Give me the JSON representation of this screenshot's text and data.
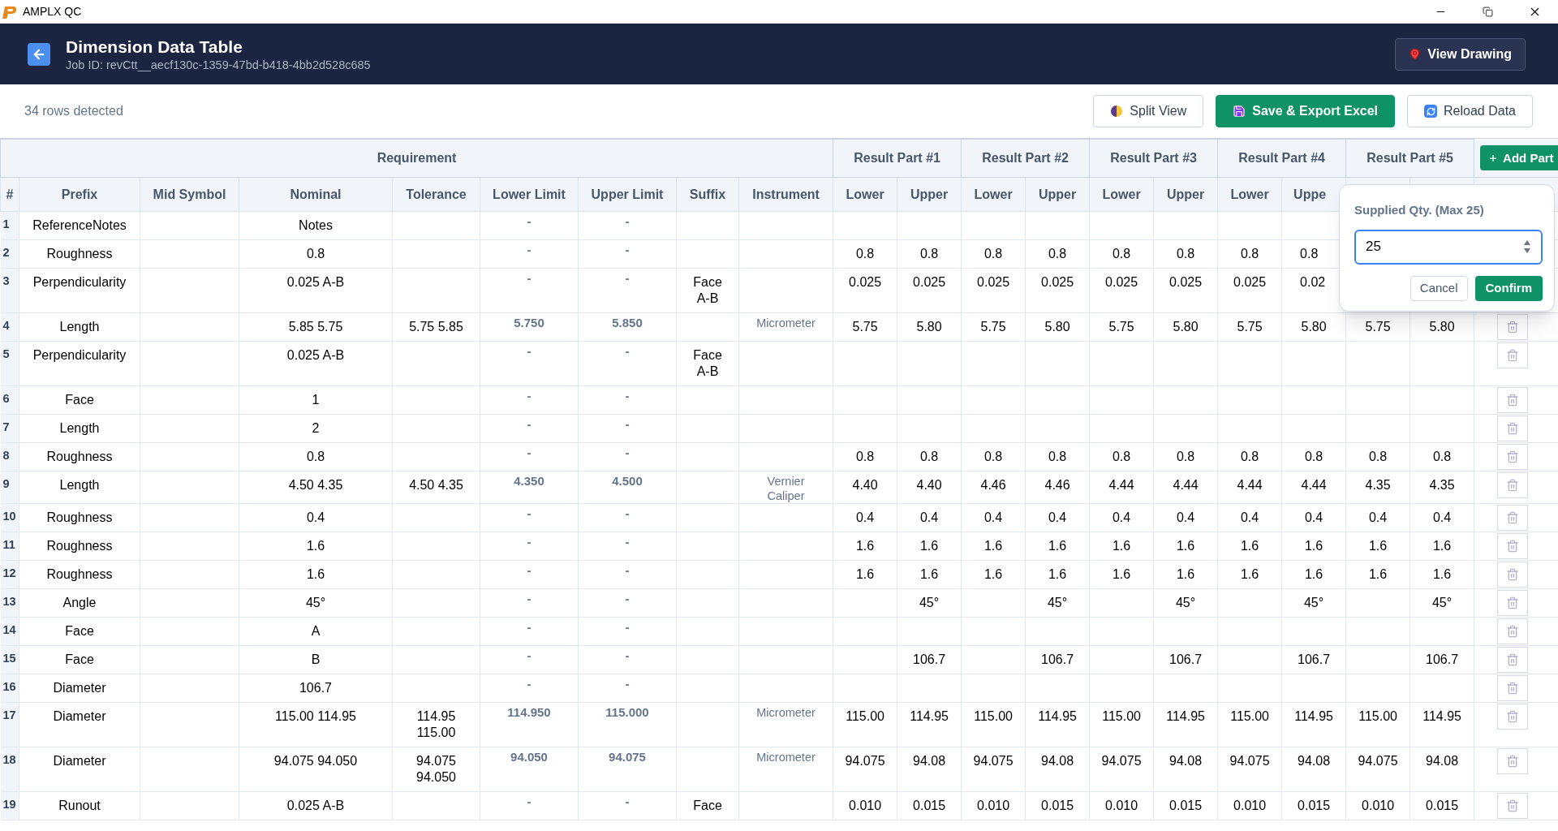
{
  "window": {
    "title": "AMPLX QC"
  },
  "header": {
    "title": "Dimension Data Table",
    "subtitle": "Job ID: revCtt__aecf130c-1359-47bd-b418-4bb2d528c685",
    "view_button": "View Drawing"
  },
  "toolbar": {
    "row_count": "34 rows detected",
    "buttons": [
      {
        "kind": "split",
        "label": "Split View"
      },
      {
        "kind": "save",
        "label": "Save & Export Excel"
      },
      {
        "kind": "reload",
        "label": "Reload Data"
      }
    ]
  },
  "table": {
    "requirement_header": "Requirement",
    "result_headers": [
      "Result Part #1",
      "Result Part #2",
      "Result Part #3",
      "Result Part #4",
      "Result Part #5"
    ],
    "add_part": "Add Part",
    "columns": [
      "#",
      "Prefix",
      "Mid Symbol",
      "Nominal",
      "Tolerance",
      "Lower Limit",
      "Upper Limit",
      "Suffix",
      "Instrument"
    ],
    "result_columns": [
      "Lower",
      "Upper",
      "Lower",
      "Upper",
      "Lower",
      "Upper",
      "Lower",
      "Uppe",
      {
        "kind": "empty"
      },
      {
        "kind": "empty"
      }
    ],
    "rows": [
      {
        "num": "1",
        "prefix": "ReferenceNotes",
        "nominal": "Notes",
        "lower": "-",
        "upper": "-",
        "results": [
          {
            "kind": "empty"
          },
          {
            "kind": "empty"
          },
          {
            "kind": "empty"
          },
          {
            "kind": "empty"
          },
          {
            "kind": "empty"
          },
          {
            "kind": "empty"
          },
          {
            "kind": "empty"
          },
          {
            "kind": "empty"
          },
          {
            "kind": "empty"
          },
          {
            "kind": "empty"
          }
        ]
      },
      {
        "num": "2",
        "prefix": "Roughness",
        "nominal": "0.8",
        "lower": "-",
        "upper": "-",
        "results": [
          "0.8",
          "0.8",
          "0.8",
          "0.8",
          "0.8",
          "0.8",
          "0.8",
          "0.8",
          {
            "kind": "empty"
          },
          {
            "kind": "empty"
          }
        ]
      },
      {
        "num": "3",
        "prefix": "Perpendicularity",
        "nominal": "0.025 A-B",
        "lower": "-",
        "upper": "-",
        "suffix": "Face A-B",
        "results": [
          "0.025",
          "0.025",
          "0.025",
          "0.025",
          "0.025",
          "0.025",
          "0.025",
          "0.02",
          {
            "kind": "empty"
          },
          {
            "kind": "empty"
          }
        ]
      },
      {
        "num": "4",
        "prefix": "Length",
        "nominal": "5.85 5.75",
        "tolerance": "5.75 5.85",
        "lower": "5.750",
        "upper": "5.850",
        "instrument": "Micrometer",
        "results": [
          "5.75",
          "5.80",
          "5.75",
          "5.80",
          "5.75",
          "5.80",
          "5.75",
          "5.80",
          "5.75",
          "5.80"
        ],
        "trash": true
      },
      {
        "num": "5",
        "prefix": "Perpendicularity",
        "nominal": "0.025 A-B",
        "lower": "-",
        "upper": "-",
        "suffix": "Face A-B",
        "results": [
          {
            "kind": "empty"
          },
          {
            "kind": "empty"
          },
          {
            "kind": "empty"
          },
          {
            "kind": "empty"
          },
          {
            "kind": "empty"
          },
          {
            "kind": "empty"
          },
          {
            "kind": "empty"
          },
          {
            "kind": "empty"
          },
          {
            "kind": "empty"
          },
          {
            "kind": "empty"
          }
        ],
        "trash": true
      },
      {
        "num": "6",
        "prefix": "Face",
        "nominal": "1",
        "lower": "-",
        "upper": "-",
        "results": [
          {
            "kind": "empty"
          },
          {
            "kind": "empty"
          },
          {
            "kind": "empty"
          },
          {
            "kind": "empty"
          },
          {
            "kind": "empty"
          },
          {
            "kind": "empty"
          },
          {
            "kind": "empty"
          },
          {
            "kind": "empty"
          },
          {
            "kind": "empty"
          },
          {
            "kind": "empty"
          }
        ],
        "trash": true
      },
      {
        "num": "7",
        "prefix": "Length",
        "nominal": "2",
        "lower": "-",
        "upper": "-",
        "results": [
          {
            "kind": "empty"
          },
          {
            "kind": "empty"
          },
          {
            "kind": "empty"
          },
          {
            "kind": "empty"
          },
          {
            "kind": "empty"
          },
          {
            "kind": "empty"
          },
          {
            "kind": "empty"
          },
          {
            "kind": "empty"
          },
          {
            "kind": "empty"
          },
          {
            "kind": "empty"
          }
        ],
        "trash": true
      },
      {
        "num": "8",
        "prefix": "Roughness",
        "nominal": "0.8",
        "lower": "-",
        "upper": "-",
        "results": [
          "0.8",
          "0.8",
          "0.8",
          "0.8",
          "0.8",
          "0.8",
          "0.8",
          "0.8",
          "0.8",
          "0.8"
        ],
        "trash": true
      },
      {
        "num": "9",
        "prefix": "Length",
        "nominal": "4.50 4.35",
        "tolerance": "4.50 4.35",
        "lower": "4.350",
        "upper": "4.500",
        "instrument": "Vernier Caliper",
        "results": [
          "4.40",
          "4.40",
          "4.46",
          "4.46",
          "4.44",
          "4.44",
          "4.44",
          "4.44",
          "4.35",
          "4.35"
        ],
        "trash": true
      },
      {
        "num": "10",
        "prefix": "Roughness",
        "nominal": "0.4",
        "lower": "-",
        "upper": "-",
        "results": [
          "0.4",
          "0.4",
          "0.4",
          "0.4",
          "0.4",
          "0.4",
          "0.4",
          "0.4",
          "0.4",
          "0.4"
        ],
        "trash": true
      },
      {
        "num": "11",
        "prefix": "Roughness",
        "nominal": "1.6",
        "lower": "-",
        "upper": "-",
        "results": [
          "1.6",
          "1.6",
          "1.6",
          "1.6",
          "1.6",
          "1.6",
          "1.6",
          "1.6",
          "1.6",
          "1.6"
        ],
        "trash": true
      },
      {
        "num": "12",
        "prefix": "Roughness",
        "nominal": "1.6",
        "lower": "-",
        "upper": "-",
        "results": [
          "1.6",
          "1.6",
          "1.6",
          "1.6",
          "1.6",
          "1.6",
          "1.6",
          "1.6",
          "1.6",
          "1.6"
        ],
        "trash": true
      },
      {
        "num": "13",
        "prefix": "Angle",
        "nominal": "45°",
        "lower": "-",
        "upper": "-",
        "results": [
          {
            "kind": "empty"
          },
          "45°",
          {
            "kind": "empty"
          },
          "45°",
          {
            "kind": "empty"
          },
          "45°",
          {
            "kind": "empty"
          },
          "45°",
          {
            "kind": "empty"
          },
          "45°"
        ],
        "trash": true
      },
      {
        "num": "14",
        "prefix": "Face",
        "nominal": "A",
        "lower": "-",
        "upper": "-",
        "results": [
          {
            "kind": "empty"
          },
          {
            "kind": "empty"
          },
          {
            "kind": "empty"
          },
          {
            "kind": "empty"
          },
          {
            "kind": "empty"
          },
          {
            "kind": "empty"
          },
          {
            "kind": "empty"
          },
          {
            "kind": "empty"
          },
          {
            "kind": "empty"
          },
          {
            "kind": "empty"
          }
        ],
        "trash": true
      },
      {
        "num": "15",
        "prefix": "Face",
        "nominal": "B",
        "lower": "-",
        "upper": "-",
        "results": [
          {
            "kind": "empty"
          },
          "106.7",
          {
            "kind": "empty"
          },
          "106.7",
          {
            "kind": "empty"
          },
          "106.7",
          {
            "kind": "empty"
          },
          "106.7",
          {
            "kind": "empty"
          },
          "106.7"
        ],
        "trash": true
      },
      {
        "num": "16",
        "prefix": "Diameter",
        "nominal": "106.7",
        "lower": "-",
        "upper": "-",
        "results": [
          {
            "kind": "empty"
          },
          {
            "kind": "empty"
          },
          {
            "kind": "empty"
          },
          {
            "kind": "empty"
          },
          {
            "kind": "empty"
          },
          {
            "kind": "empty"
          },
          {
            "kind": "empty"
          },
          {
            "kind": "empty"
          },
          {
            "kind": "empty"
          },
          {
            "kind": "empty"
          }
        ],
        "trash": true
      },
      {
        "num": "17",
        "prefix": "Diameter",
        "nominal": "115.00 114.95",
        "tolerance": "114.95 115.00",
        "lower": "114.950",
        "upper": "115.000",
        "instrument": "Micrometer",
        "results": [
          "115.00",
          "114.95",
          "115.00",
          "114.95",
          "115.00",
          "114.95",
          "115.00",
          "114.95",
          "115.00",
          "114.95"
        ],
        "trash": true
      },
      {
        "num": "18",
        "prefix": "Diameter",
        "nominal": "94.075 94.050",
        "tolerance": "94.075 94.050",
        "lower": "94.050",
        "upper": "94.075",
        "instrument": "Micrometer",
        "results": [
          "94.075",
          "94.08",
          "94.075",
          "94.08",
          "94.075",
          "94.08",
          "94.075",
          "94.08",
          "94.075",
          "94.08"
        ],
        "trash": true
      },
      {
        "num": "19",
        "prefix": "Runout",
        "nominal": "0.025 A-B",
        "lower": "-",
        "upper": "-",
        "suffix": "Face",
        "results": [
          "0.010",
          "0.015",
          "0.010",
          "0.015",
          "0.010",
          "0.015",
          "0.010",
          "0.015",
          "0.010",
          "0.015"
        ],
        "trash": true
      }
    ]
  },
  "popup": {
    "label": "Supplied Qty. (Max 25)",
    "value": "25",
    "buttons": [
      {
        "kind": "cancel",
        "label": "Cancel"
      },
      {
        "kind": "confirm",
        "label": "Confirm"
      }
    ]
  }
}
